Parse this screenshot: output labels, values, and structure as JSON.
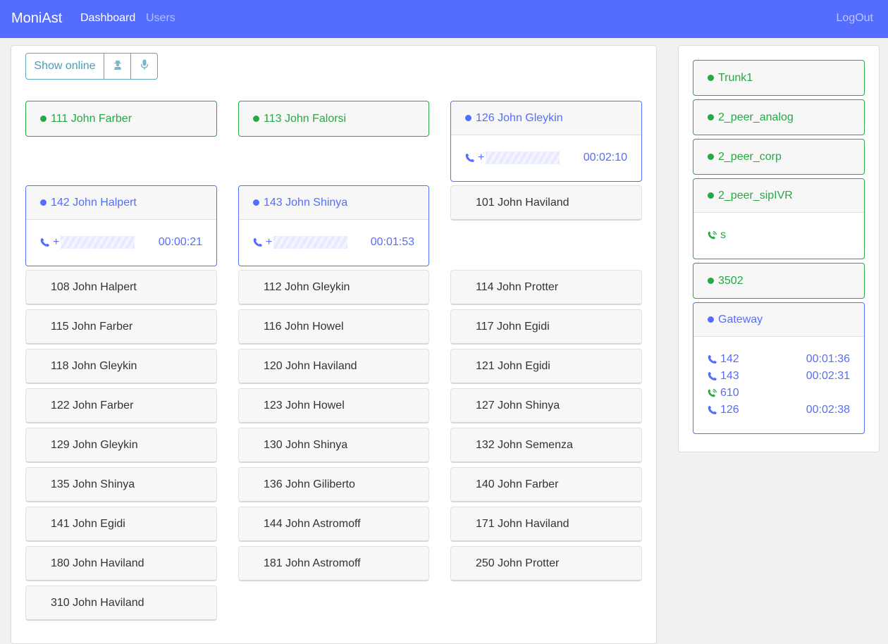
{
  "nav": {
    "brand": "MoniAst",
    "links": [
      "Dashboard",
      "Users"
    ],
    "logout": "LogOut",
    "colors": {
      "bar": "#556dff"
    }
  },
  "toolbar": {
    "show_online": "Show online",
    "icons": [
      "user-secret-icon",
      "microphone-icon"
    ]
  },
  "peers": {
    "active": [
      {
        "name": "111 John Farber",
        "status": "online"
      },
      {
        "name": "113 John Falorsi",
        "status": "online"
      },
      {
        "name": "126 John Gleykin",
        "status": "in-call",
        "number_prefix": "+",
        "duration": "00:02:10"
      },
      {
        "name": "142 John Halpert",
        "status": "in-call",
        "number_prefix": "+",
        "duration": "00:00:21"
      },
      {
        "name": "143 John Shinya",
        "status": "in-call",
        "number_prefix": "+",
        "duration": "00:01:53"
      }
    ],
    "offline": [
      "101 John Haviland",
      "108 John Halpert",
      "112 John Gleykin",
      "114 John Protter",
      "115 John Farber",
      "116 John Howel",
      "117 John Egidi",
      "118 John Gleykin",
      "120 John Haviland",
      "121 John Egidi",
      "122 John Farber",
      "123 John Howel",
      "127 John Shinya",
      "129 John Gleykin",
      "130 John Shinya",
      "132 John Semenza",
      "135 John Shinya",
      "136 John Giliberto",
      "140 John Farber",
      "141 John Egidi",
      "144 John Astromoff",
      "171 John Haviland",
      "180 John Haviland",
      "181 John Astromoff",
      "250 John Protter",
      "310 John Haviland"
    ]
  },
  "trunks": [
    {
      "name": "Trunk1",
      "status": "online"
    },
    {
      "name": "2_peer_analog",
      "status": "online"
    },
    {
      "name": "2_peer_corp",
      "status": "online"
    },
    {
      "name": "2_peer_sipIVR",
      "status": "online",
      "calls": [
        {
          "icon": "phone-ringing-icon",
          "label": "s",
          "duration": ""
        }
      ]
    },
    {
      "name": "3502",
      "status": "online"
    },
    {
      "name": "Gateway",
      "status": "in-call",
      "calls": [
        {
          "icon": "phone-icon",
          "label": "142",
          "duration": "00:01:36"
        },
        {
          "icon": "phone-icon",
          "label": "143",
          "duration": "00:02:31"
        },
        {
          "icon": "phone-ringing-icon",
          "label": "610",
          "duration": ""
        },
        {
          "icon": "phone-icon",
          "label": "126",
          "duration": "00:02:38"
        }
      ]
    }
  ],
  "colors": {
    "online": "#28a745",
    "in_call": "#556dff",
    "accent_button": "#4a9cb3"
  }
}
